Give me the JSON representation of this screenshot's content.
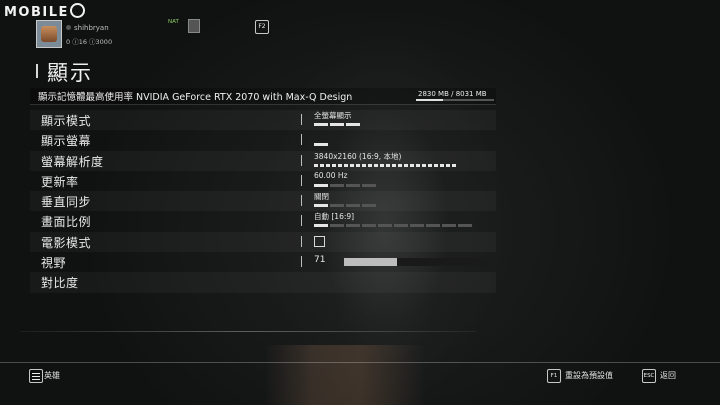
{
  "watermark": {
    "logo_text": "MOBILE"
  },
  "user": {
    "name": "shihbryan",
    "stats": "0 ⓘ16 ⓘ3000"
  },
  "topbar": {
    "nat_label": "NAT",
    "f2_key": "F2"
  },
  "page": {
    "title": "顯示"
  },
  "memory": {
    "label": "顯示記憶體最高使用率  NVIDIA GeForce RTX 2070 with Max-Q Design",
    "usage_text": "2830 MB / 8031 MB",
    "used_mb": 2830,
    "total_mb": 8031
  },
  "settings": [
    {
      "label": "顯示模式",
      "type": "select",
      "value": "全螢幕顯示",
      "segments": 3,
      "selected": 3
    },
    {
      "label": "顯示螢幕",
      "type": "select",
      "value": "",
      "segments": 1,
      "selected": 1
    },
    {
      "label": "螢幕解析度",
      "type": "select",
      "value": "3840x2160 (16:9, 本地)",
      "segments": 24,
      "selected": 24
    },
    {
      "label": "更新率",
      "type": "select",
      "value": "60.00 Hz",
      "segments": 4,
      "selected": 1
    },
    {
      "label": "垂直同步",
      "type": "select",
      "value": "關閉",
      "segments": 4,
      "selected": 1
    },
    {
      "label": "畫面比例",
      "type": "select",
      "value": "自動 [16:9]",
      "segments": 10,
      "selected": 1
    },
    {
      "label": "電影模式",
      "type": "checkbox",
      "checked": false
    },
    {
      "label": "視野",
      "type": "slider",
      "value": "71",
      "fraction": 0.37
    },
    {
      "label": "對比度",
      "type": "blank"
    }
  ],
  "footer": {
    "hero_label": "英雄",
    "f1_key": "F1",
    "reset_label": "重設為預設值",
    "esc_key": "ESC",
    "back_label": "返回"
  },
  "colors": {
    "accent": "#e6e6e6",
    "nat_green": "#8fd16b"
  }
}
